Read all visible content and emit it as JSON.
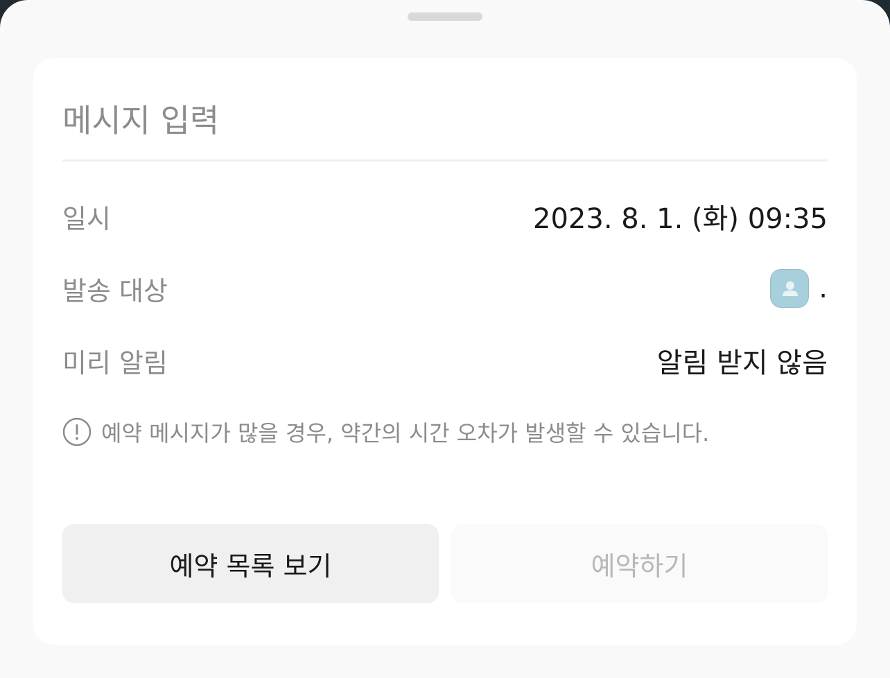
{
  "sheet": {
    "grabber": "drag-handle"
  },
  "message": {
    "placeholder": "메시지 입력",
    "value": ""
  },
  "rows": {
    "date": {
      "label": "일시",
      "value": "2023. 8. 1. (화) 09:35"
    },
    "target": {
      "label": "발송 대상",
      "avatar_icon": "person-icon",
      "name": "."
    },
    "alarm": {
      "label": "미리 알림",
      "value": "알림 받지 않음"
    }
  },
  "notice": {
    "icon": "exclamation-circle-icon",
    "text": "예약 메시지가 많을 경우, 약간의 시간 오차가 발생할 수 있습니다."
  },
  "buttons": {
    "list_label": "예약 목록 보기",
    "reserve_label": "예약하기"
  },
  "colors": {
    "avatar_bg": "#a8cfdc",
    "primary_button_bg": "#f0f0f0",
    "disabled_text": "#b8b8b8"
  }
}
